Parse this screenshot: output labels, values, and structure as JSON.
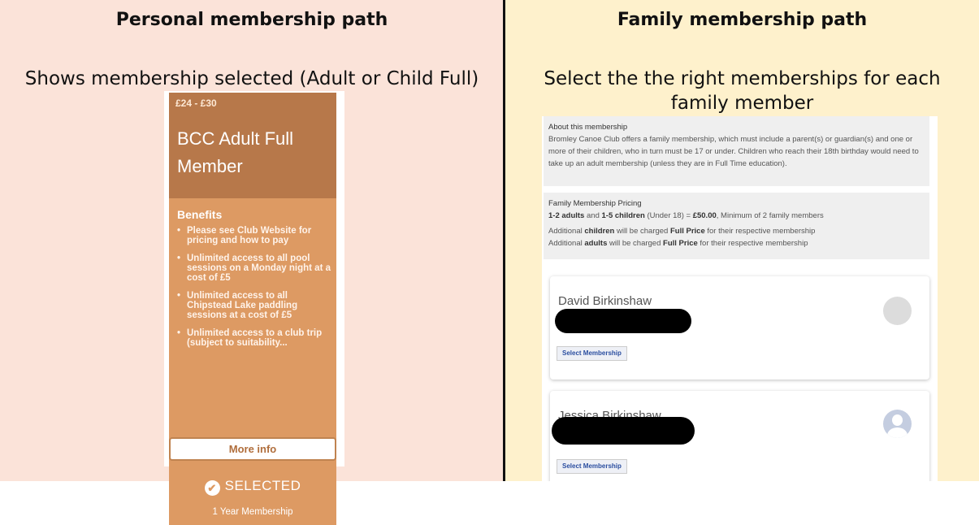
{
  "left": {
    "title": "Personal membership path",
    "subtitle": "Shows membership selected (Adult or Child Full)",
    "card": {
      "price": "£24 - £30",
      "name": "BCC Adult Full Member",
      "benefits_title": "Benefits",
      "benefits": [
        "Please see Club Website for pricing and how to pay",
        "Unlimited access to all pool sessions on a Monday night at a cost of £5",
        "Unlimited access to all Chipstead Lake paddling sessions at a cost of £5",
        "Unlimited access to a club trip (subject to suitability..."
      ],
      "selected_label": "SELECTED",
      "check_icon": "✔",
      "duration": "1 Year Membership",
      "more_info_label": "More info"
    }
  },
  "right": {
    "title": "Family membership path",
    "subtitle": "Select the the right memberships for each family member",
    "about": {
      "title": "About this membership",
      "text": "Bromley Canoe Club offers a family membership, which must include a parent(s) or guardian(s) and one or more of their children, who in turn must be 17 or under. Children who reach their 18th birthday would need to take up an adult membership (unless they are in Full Time education)."
    },
    "pricing": {
      "title": "Family Membership Pricing",
      "adults": "1-2 adults",
      "and": " and ",
      "children": "1-5 children",
      "under": " (Under 18) = ",
      "price": "£50.00",
      "minimum": ", Minimum of 2 family members",
      "line2_a": "Additional ",
      "line2_b": "children",
      "line2_c": " will be charged ",
      "line2_d": "Full Price",
      "line2_e": " for their respective membership",
      "line3_a": "Additional ",
      "line3_b": "adults",
      "line3_c": " will be charged ",
      "line3_d": "Full Price",
      "line3_e": " for their respective membership"
    },
    "members": [
      {
        "name": "David Birkinshaw",
        "button": "Select Membership"
      },
      {
        "name": "Jessica Birkinshaw",
        "button": "Select Membership"
      }
    ]
  }
}
